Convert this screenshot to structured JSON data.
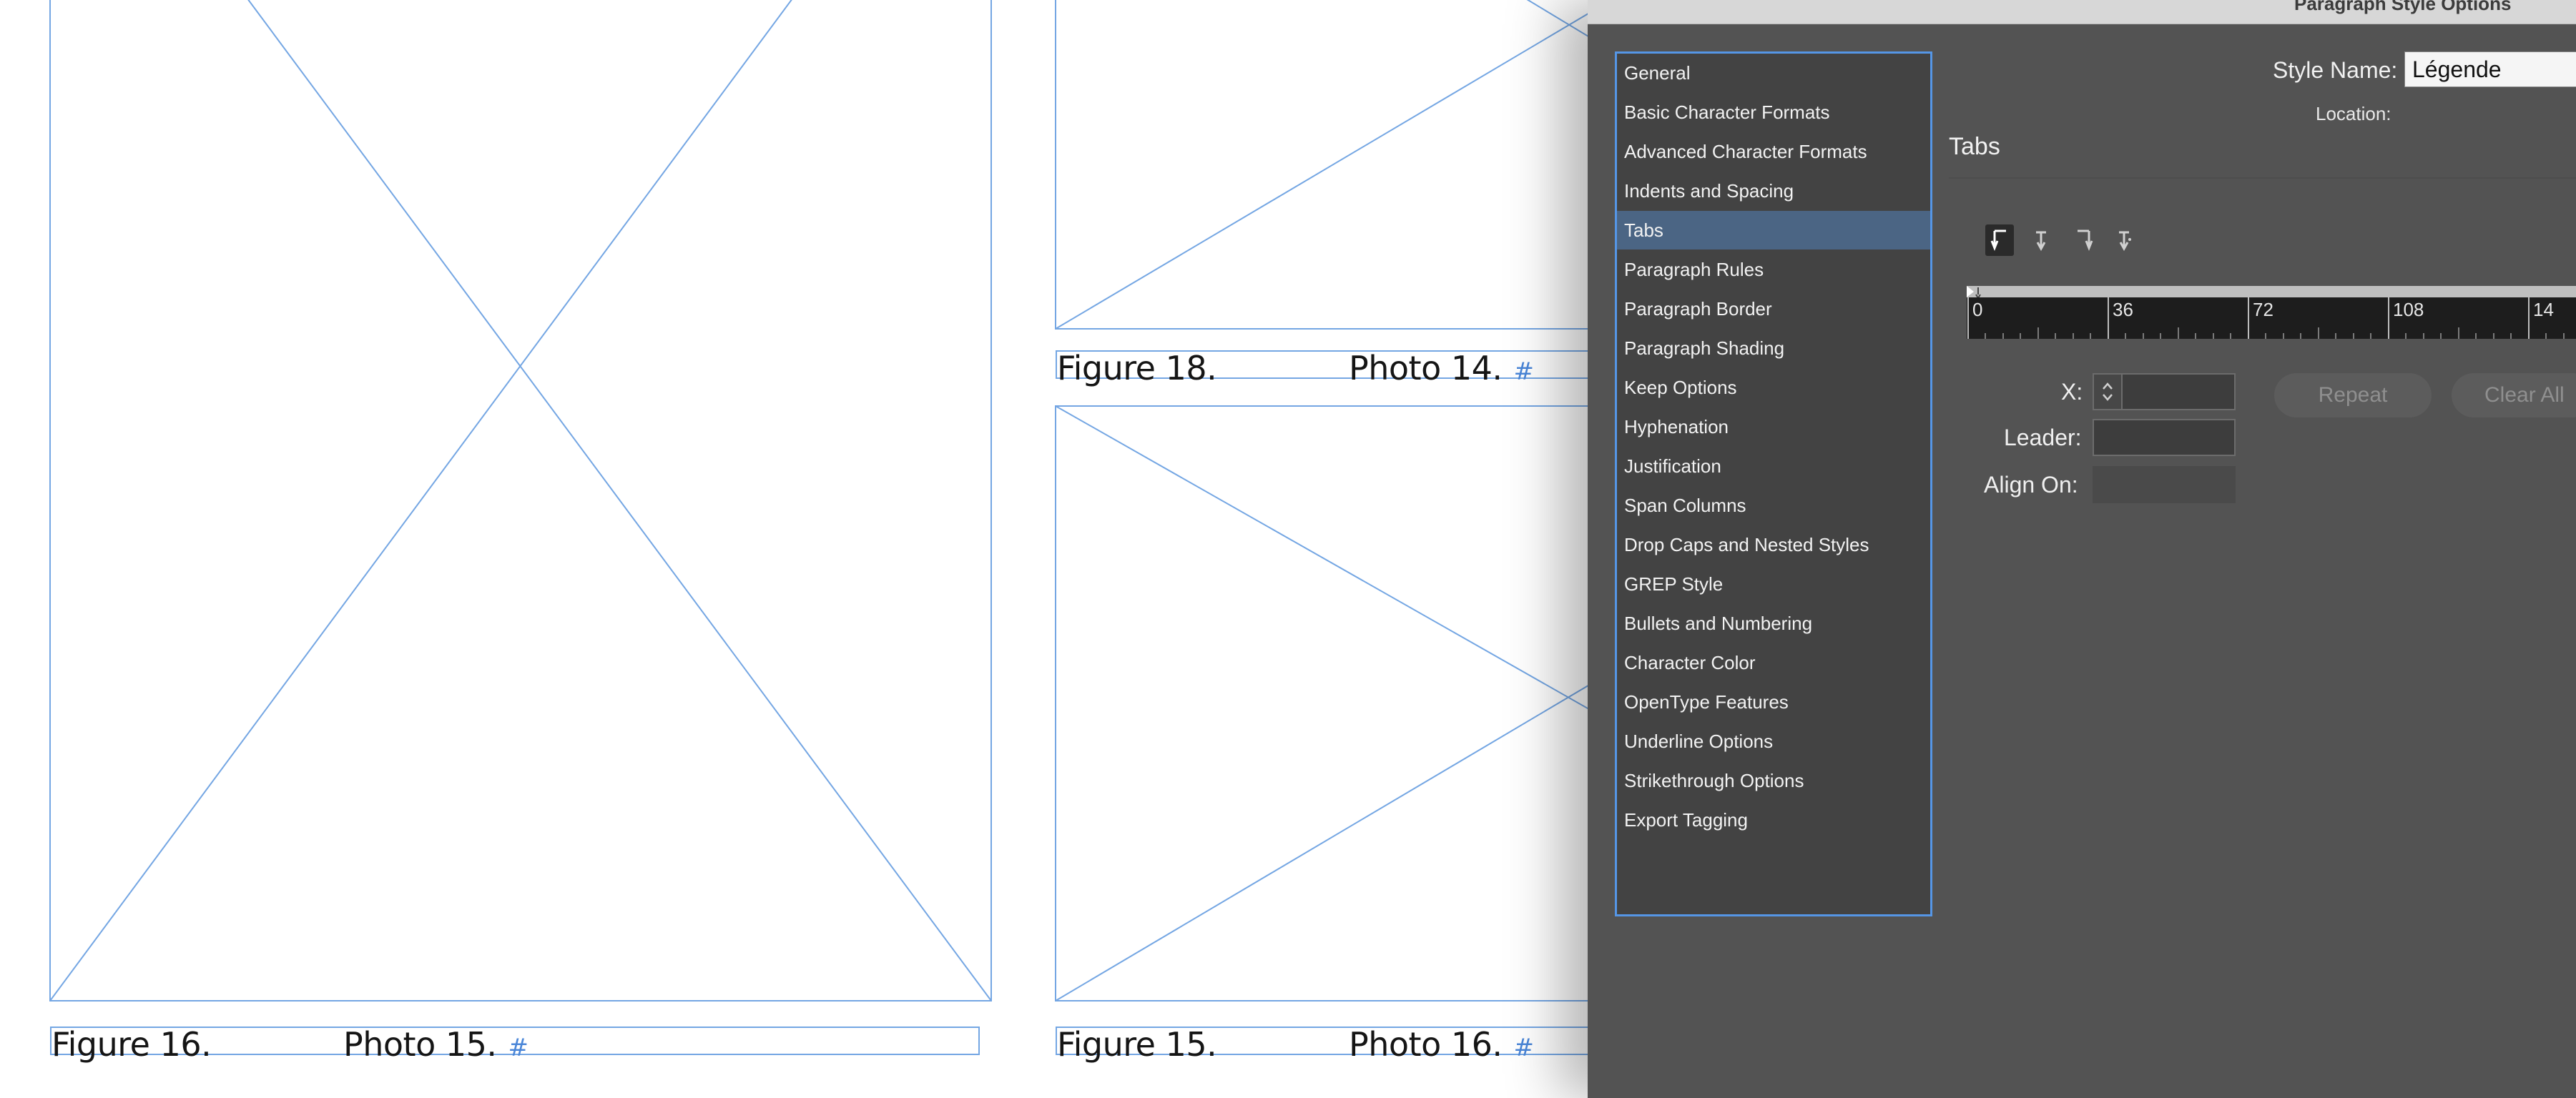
{
  "document": {
    "captions": [
      {
        "figure": "Figure 16.",
        "photo": "Photo 15.",
        "mark": "#"
      },
      {
        "figure": "Figure 18.",
        "photo": "Photo 14.",
        "mark": "#"
      },
      {
        "figure": "Figure 15.",
        "photo": "Photo 16.",
        "mark": "#"
      }
    ]
  },
  "dialog": {
    "title": "Paragraph Style Options",
    "style_name_label": "Style Name:",
    "style_name_value": "Légende",
    "location_label": "Location:",
    "section_title": "Tabs",
    "categories": [
      "General",
      "Basic Character Formats",
      "Advanced Character Formats",
      "Indents and Spacing",
      "Tabs",
      "Paragraph Rules",
      "Paragraph Border",
      "Paragraph Shading",
      "Keep Options",
      "Hyphenation",
      "Justification",
      "Span Columns",
      "Drop Caps and Nested Styles",
      "GREP Style",
      "Bullets and Numbering",
      "Character Color",
      "OpenType Features",
      "Underline Options",
      "Strikethrough Options",
      "Export Tagging"
    ],
    "selected_category": "Tabs",
    "ruler": {
      "labels": [
        "0",
        "36",
        "72",
        "108",
        "14"
      ]
    },
    "tab_settings": {
      "x_label": "X:",
      "x_value": "",
      "leader_label": "Leader:",
      "leader_value": "",
      "align_on_label": "Align On:",
      "align_on_value": "",
      "repeat_label": "Repeat",
      "clear_all_label": "Clear All"
    },
    "tab_alignment_icons": [
      "left-justified-tab-icon",
      "center-justified-tab-icon",
      "right-justified-tab-icon",
      "align-to-decimal-tab-icon"
    ],
    "colors": {
      "dialog_bg": "#535353",
      "list_border": "#5596e6",
      "selected_row": "#4b6584",
      "frame_stroke": "#74a6e3"
    }
  }
}
